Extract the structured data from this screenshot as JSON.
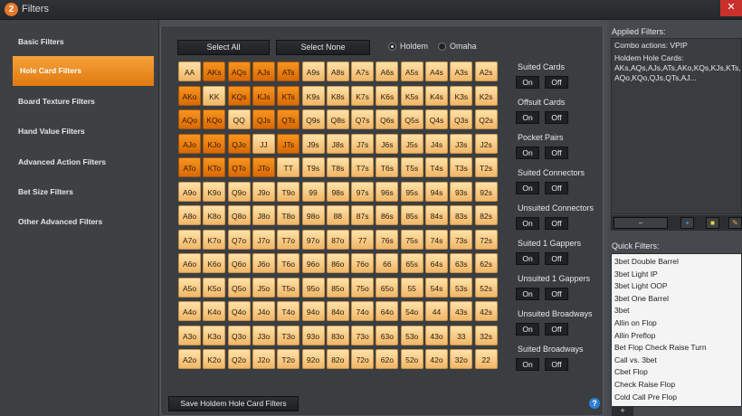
{
  "window": {
    "title": "Filters",
    "icon_glyph": "2",
    "close_glyph": "✕"
  },
  "sidebar": {
    "items": [
      {
        "label": "Basic Filters"
      },
      {
        "label": "Hole Card Filters"
      },
      {
        "label": "Board Texture Filters"
      },
      {
        "label": "Hand Value Filters"
      },
      {
        "label": "Advanced Action Filters"
      },
      {
        "label": "Bet Size Filters"
      },
      {
        "label": "Other Advanced Filters"
      }
    ],
    "active_index": 1
  },
  "toolbar": {
    "select_all": "Select All",
    "select_none": "Select None",
    "game_options": [
      "Holdem",
      "Omaha"
    ],
    "selected_game": "Holdem"
  },
  "grid": {
    "rows": [
      [
        "AA",
        "AKs",
        "AQs",
        "AJs",
        "ATs",
        "A9s",
        "A8s",
        "A7s",
        "A6s",
        "A5s",
        "A4s",
        "A3s",
        "A2s"
      ],
      [
        "AKo",
        "KK",
        "KQs",
        "KJs",
        "KTs",
        "K9s",
        "K8s",
        "K7s",
        "K6s",
        "K5s",
        "K4s",
        "K3s",
        "K2s"
      ],
      [
        "AQo",
        "KQo",
        "QQ",
        "QJs",
        "QTs",
        "Q9s",
        "Q8s",
        "Q7s",
        "Q6s",
        "Q5s",
        "Q4s",
        "Q3s",
        "Q2s"
      ],
      [
        "AJo",
        "KJo",
        "QJo",
        "JJ",
        "JTs",
        "J9s",
        "J8s",
        "J7s",
        "J6s",
        "J5s",
        "J4s",
        "J3s",
        "J2s"
      ],
      [
        "ATo",
        "KTo",
        "QTo",
        "JTo",
        "TT",
        "T9s",
        "T8s",
        "T7s",
        "T6s",
        "T5s",
        "T4s",
        "T3s",
        "T2s"
      ],
      [
        "A9o",
        "K9o",
        "Q9o",
        "J9o",
        "T9o",
        "99",
        "98s",
        "97s",
        "96s",
        "95s",
        "94s",
        "93s",
        "92s"
      ],
      [
        "A8o",
        "K8o",
        "Q8o",
        "J8o",
        "T8o",
        "98o",
        "88",
        "87s",
        "86s",
        "85s",
        "84s",
        "83s",
        "82s"
      ],
      [
        "A7o",
        "K7o",
        "Q7o",
        "J7o",
        "T7o",
        "97o",
        "87o",
        "77",
        "76s",
        "75s",
        "74s",
        "73s",
        "72s"
      ],
      [
        "A6o",
        "K6o",
        "Q6o",
        "J6o",
        "T6o",
        "96o",
        "86o",
        "76o",
        "66",
        "65s",
        "64s",
        "63s",
        "62s"
      ],
      [
        "A5o",
        "K5o",
        "Q5o",
        "J5o",
        "T5o",
        "95o",
        "85o",
        "75o",
        "65o",
        "55",
        "54s",
        "53s",
        "52s"
      ],
      [
        "A4o",
        "K4o",
        "Q4o",
        "J4o",
        "T4o",
        "94o",
        "84o",
        "74o",
        "64o",
        "54o",
        "44",
        "43s",
        "42s"
      ],
      [
        "A3o",
        "K3o",
        "Q3o",
        "J3o",
        "T3o",
        "93o",
        "83o",
        "73o",
        "63o",
        "53o",
        "43o",
        "33",
        "32s"
      ],
      [
        "A2o",
        "K2o",
        "Q2o",
        "J2o",
        "T2o",
        "92o",
        "82o",
        "72o",
        "62o",
        "52o",
        "42o",
        "32o",
        "22"
      ]
    ],
    "selected": [
      "AKs",
      "AQs",
      "AJs",
      "ATs",
      "AKo",
      "KQs",
      "KJs",
      "KTs",
      "AQo",
      "KQo",
      "QJs",
      "QTs",
      "AJo",
      "KJo",
      "QJo",
      "JTs",
      "ATo",
      "KTo",
      "QTo",
      "JTo"
    ]
  },
  "side_filters": [
    {
      "label": "Suited Cards",
      "on": "On",
      "off": "Off"
    },
    {
      "label": "Offsuit Cards",
      "on": "On",
      "off": "Off"
    },
    {
      "label": "Pocket Pairs",
      "on": "On",
      "off": "Off"
    },
    {
      "label": "Suited Connectors",
      "on": "On",
      "off": "Off"
    },
    {
      "label": "Unsuited Connectors",
      "on": "On",
      "off": "Off"
    },
    {
      "label": "Suited 1 Gappers",
      "on": "On",
      "off": "Off"
    },
    {
      "label": "Unsuited 1 Gappers",
      "on": "On",
      "off": "Off"
    },
    {
      "label": "Unsuited Broadways",
      "on": "On",
      "off": "Off"
    },
    {
      "label": "Suited Broadways",
      "on": "On",
      "off": "Off"
    }
  ],
  "footer": {
    "save_label": "Save Holdem Hole Card Filters",
    "help_glyph": "?"
  },
  "applied_filters": {
    "heading": "Applied Filters:",
    "lines": [
      "Combo actions: VPIP",
      "Holdem Hole Cards:",
      "AKs,AQs,AJs,ATs,AKo,KQs,KJs,KTs,",
      "AQo,KQo,QJs,QTs,AJ..."
    ],
    "toolbar_glyphs": {
      "minus": "−",
      "save": "▪",
      "folder": "■",
      "edit": "✎"
    }
  },
  "quick_filters": {
    "heading": "Quick Filters:",
    "items": [
      "3bet Double Barrel",
      "3bet Light IP",
      "3bet Light OOP",
      "3bet One Barrel",
      "3bet",
      "Allin on Flop",
      "Allin Preflop",
      "Bet Flop Check Raise Turn",
      "Call vs. 3bet",
      "Cbet Flop",
      "Check Raise Flop",
      "Cold Call Pre Flop"
    ],
    "add_glyph": "+"
  },
  "colors": {
    "accent": "#e07a10",
    "cell": "#f1b768",
    "cell_selected": "#d96a05"
  }
}
